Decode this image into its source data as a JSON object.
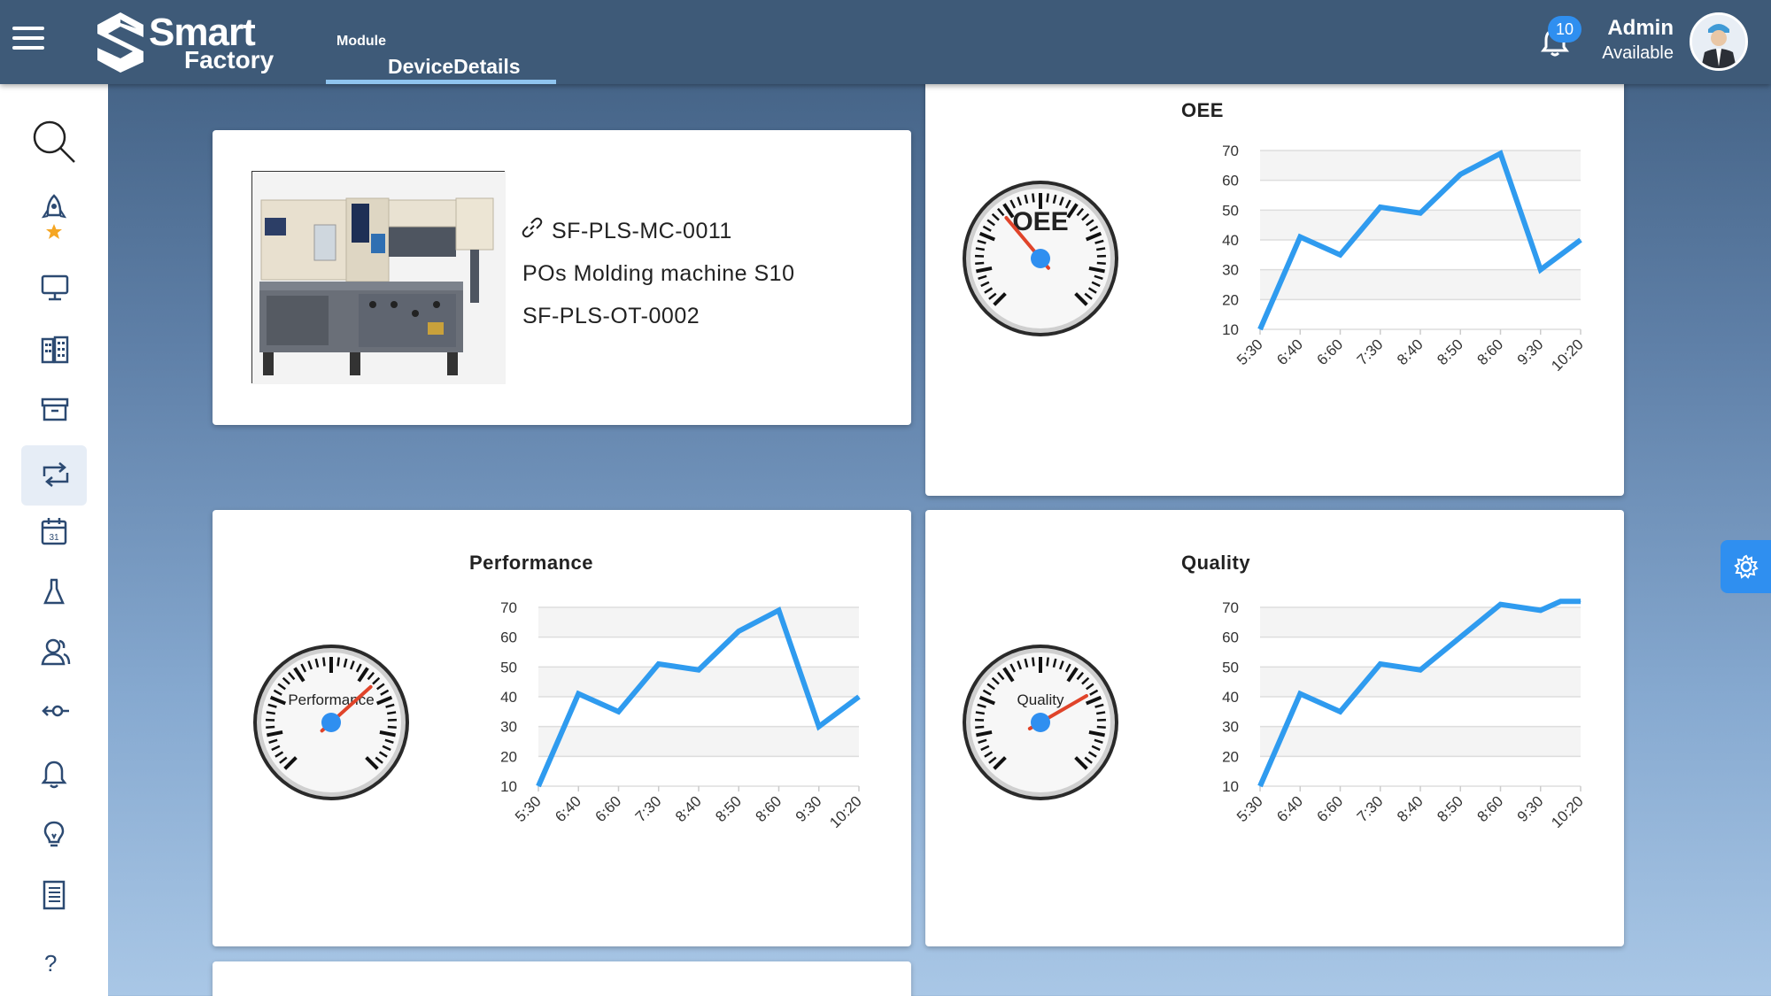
{
  "header": {
    "logo_line1": "Smart",
    "logo_line2": "Factory",
    "module_label": "Module",
    "module_title": "DeviceDetails",
    "notification_count": "10",
    "user_name": "Admin",
    "user_status": "Available"
  },
  "sidebar": {
    "items": [
      {
        "icon": "search-icon"
      },
      {
        "icon": "rocket-star-icon"
      },
      {
        "icon": "monitor-icon"
      },
      {
        "icon": "building-icon"
      },
      {
        "icon": "archive-box-icon"
      },
      {
        "icon": "repeat-arrows-icon",
        "active": true
      },
      {
        "icon": "calendar-icon",
        "day": "31"
      },
      {
        "icon": "flask-icon"
      },
      {
        "icon": "users-icon"
      },
      {
        "icon": "commit-icon"
      },
      {
        "icon": "bell-icon"
      },
      {
        "icon": "lightbulb-icon"
      },
      {
        "icon": "notebook-icon"
      },
      {
        "icon": "help-icon",
        "glyph": "?"
      }
    ]
  },
  "device": {
    "id": "SF-PLS-MC-0011",
    "name": "POs Molding machine S10",
    "code": "SF-PLS-OT-0002"
  },
  "oee": {
    "title": "OEE",
    "gauge_label": "OEE"
  },
  "performance": {
    "title": "Performance",
    "gauge_label": "Performance"
  },
  "quality": {
    "title": "Quality",
    "gauge_label": "Quality"
  },
  "colors": {
    "topbar": "#3e5a78",
    "accent": "#2f8ff0",
    "line": "#2f9bef",
    "needle": "#e0442a"
  },
  "chart_data": [
    {
      "type": "line",
      "title": "OEE",
      "categories": [
        "5:30",
        "6:40",
        "6:60",
        "7:30",
        "8:40",
        "8:50",
        "8:60",
        "9:30",
        "10:20"
      ],
      "series": [
        {
          "values": [
            10,
            41,
            35,
            51,
            49,
            62,
            69,
            30,
            40
          ]
        }
      ],
      "yticks": [
        10,
        20,
        30,
        40,
        50,
        60,
        70
      ],
      "ylim": [
        10,
        70
      ],
      "grid": true
    },
    {
      "type": "line",
      "title": "Performance",
      "categories": [
        "5:30",
        "6:40",
        "6:60",
        "7:30",
        "8:40",
        "8:50",
        "8:60",
        "9:30",
        "10:20"
      ],
      "series": [
        {
          "values": [
            10,
            41,
            35,
            51,
            49,
            62,
            69,
            30,
            40
          ]
        }
      ],
      "yticks": [
        10,
        20,
        30,
        40,
        50,
        60,
        70
      ],
      "ylim": [
        10,
        70
      ],
      "grid": true
    },
    {
      "type": "line",
      "title": "Quality",
      "categories": [
        "5:30",
        "6:40",
        "6:60",
        "7:30",
        "8:40",
        "8:50",
        "8:60",
        "9:30",
        "10:20"
      ],
      "series": [
        {
          "values": [
            10,
            41,
            35,
            51,
            49,
            60,
            71,
            69,
            72,
            72
          ]
        }
      ],
      "x_positions": [
        0,
        1,
        2,
        3,
        4,
        5,
        6,
        7,
        7.5,
        8
      ],
      "yticks": [
        10,
        20,
        30,
        40,
        50,
        60,
        70
      ],
      "ylim": [
        10,
        70
      ],
      "grid": true
    }
  ]
}
